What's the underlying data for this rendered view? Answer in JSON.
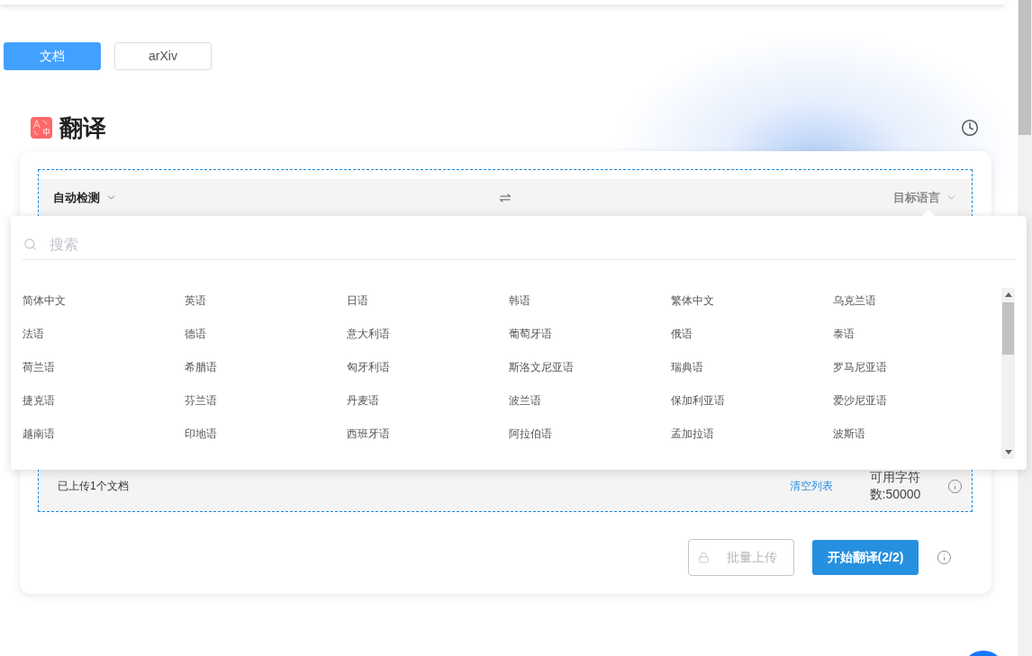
{
  "mode_tabs": [
    {
      "label": "文档",
      "selected": true
    },
    {
      "label": "arXiv",
      "selected": false
    }
  ],
  "title": "翻译",
  "translator": {
    "source_language": {
      "value": "自动检测"
    },
    "target_language": {
      "placeholder": "目标语言",
      "open": true
    },
    "language_dropdown": {
      "search": {
        "placeholder": "搜索"
      },
      "options": [
        {
          "label": "简体中文",
          "selected": false
        },
        {
          "label": "英语",
          "selected": false
        },
        {
          "label": "日语",
          "selected": false
        },
        {
          "label": "韩语",
          "selected": false
        },
        {
          "label": "繁体中文",
          "selected": false
        },
        {
          "label": "乌克兰语",
          "selected": false
        },
        {
          "label": "法语",
          "selected": false
        },
        {
          "label": "德语",
          "selected": false
        },
        {
          "label": "意大利语",
          "selected": false
        },
        {
          "label": "葡萄牙语",
          "selected": false
        },
        {
          "label": "俄语",
          "selected": false
        },
        {
          "label": "泰语",
          "selected": false
        },
        {
          "label": "荷兰语",
          "selected": false
        },
        {
          "label": "希腊语",
          "selected": false
        },
        {
          "label": "匈牙利语",
          "selected": false
        },
        {
          "label": "斯洛文尼亚语",
          "selected": false
        },
        {
          "label": "瑞典语",
          "selected": false
        },
        {
          "label": "罗马尼亚语",
          "selected": false
        },
        {
          "label": "捷克语",
          "selected": false
        },
        {
          "label": "芬兰语",
          "selected": false
        },
        {
          "label": "丹麦语",
          "selected": false
        },
        {
          "label": "波兰语",
          "selected": false
        },
        {
          "label": "保加利亚语",
          "selected": false
        },
        {
          "label": "爱沙尼亚语",
          "selected": false
        },
        {
          "label": "越南语",
          "selected": false
        },
        {
          "label": "印地语",
          "selected": false
        },
        {
          "label": "西班牙语",
          "selected": false
        },
        {
          "label": "阿拉伯语",
          "selected": false
        },
        {
          "label": "孟加拉语",
          "selected": false
        },
        {
          "label": "波斯语",
          "selected": false
        }
      ]
    },
    "upload_status": "已上传1个文档",
    "clear_link": "清空列表",
    "char_quota": "可用字符数:50000",
    "buttons": [
      {
        "label": "批量上传",
        "kind": "upload",
        "disabled": true
      },
      {
        "label": "开始翻译(2/2)",
        "kind": "primary",
        "disabled": false
      }
    ]
  }
}
